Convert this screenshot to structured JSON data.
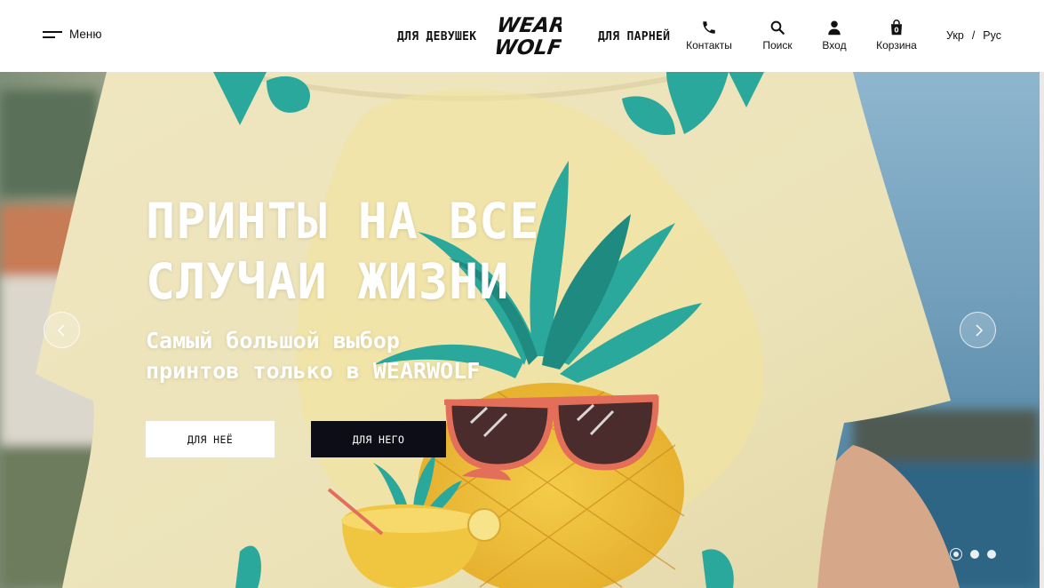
{
  "header": {
    "menu_label": "Меню",
    "nav_girls": "ДЛЯ ДЕВУШЕК",
    "nav_boys": "ДЛЯ ПАРНЕЙ",
    "logo_line1": "WEAR",
    "logo_line2": "WOLF",
    "contacts_label": "Контакты",
    "search_label": "Поиск",
    "login_label": "Вход",
    "cart_label": "Корзина",
    "cart_count": "0",
    "lang_ukr": "Укр",
    "lang_sep": "/",
    "lang_rus": "Рус"
  },
  "hero": {
    "title_line1": "ПРИНТЫ НА ВСЕ",
    "title_line2": "СЛУЧАИ ЖИЗНИ",
    "subtitle_line1": "Самый большой выбор",
    "subtitle_line2": "принтов только в WEARWOLF",
    "btn_her": "ДЛЯ НЕЁ",
    "btn_him": "ДЛЯ НЕГО",
    "slides_total": 3,
    "active_slide": 1
  },
  "icons": [
    "burger-menu-icon",
    "phone-icon",
    "search-icon",
    "user-icon",
    "cart-bag-icon",
    "chevron-left-icon",
    "chevron-right-icon"
  ],
  "colors": {
    "text": "#111111",
    "btn_dark": "#0d0d18",
    "hero_text": "#ffffff"
  }
}
